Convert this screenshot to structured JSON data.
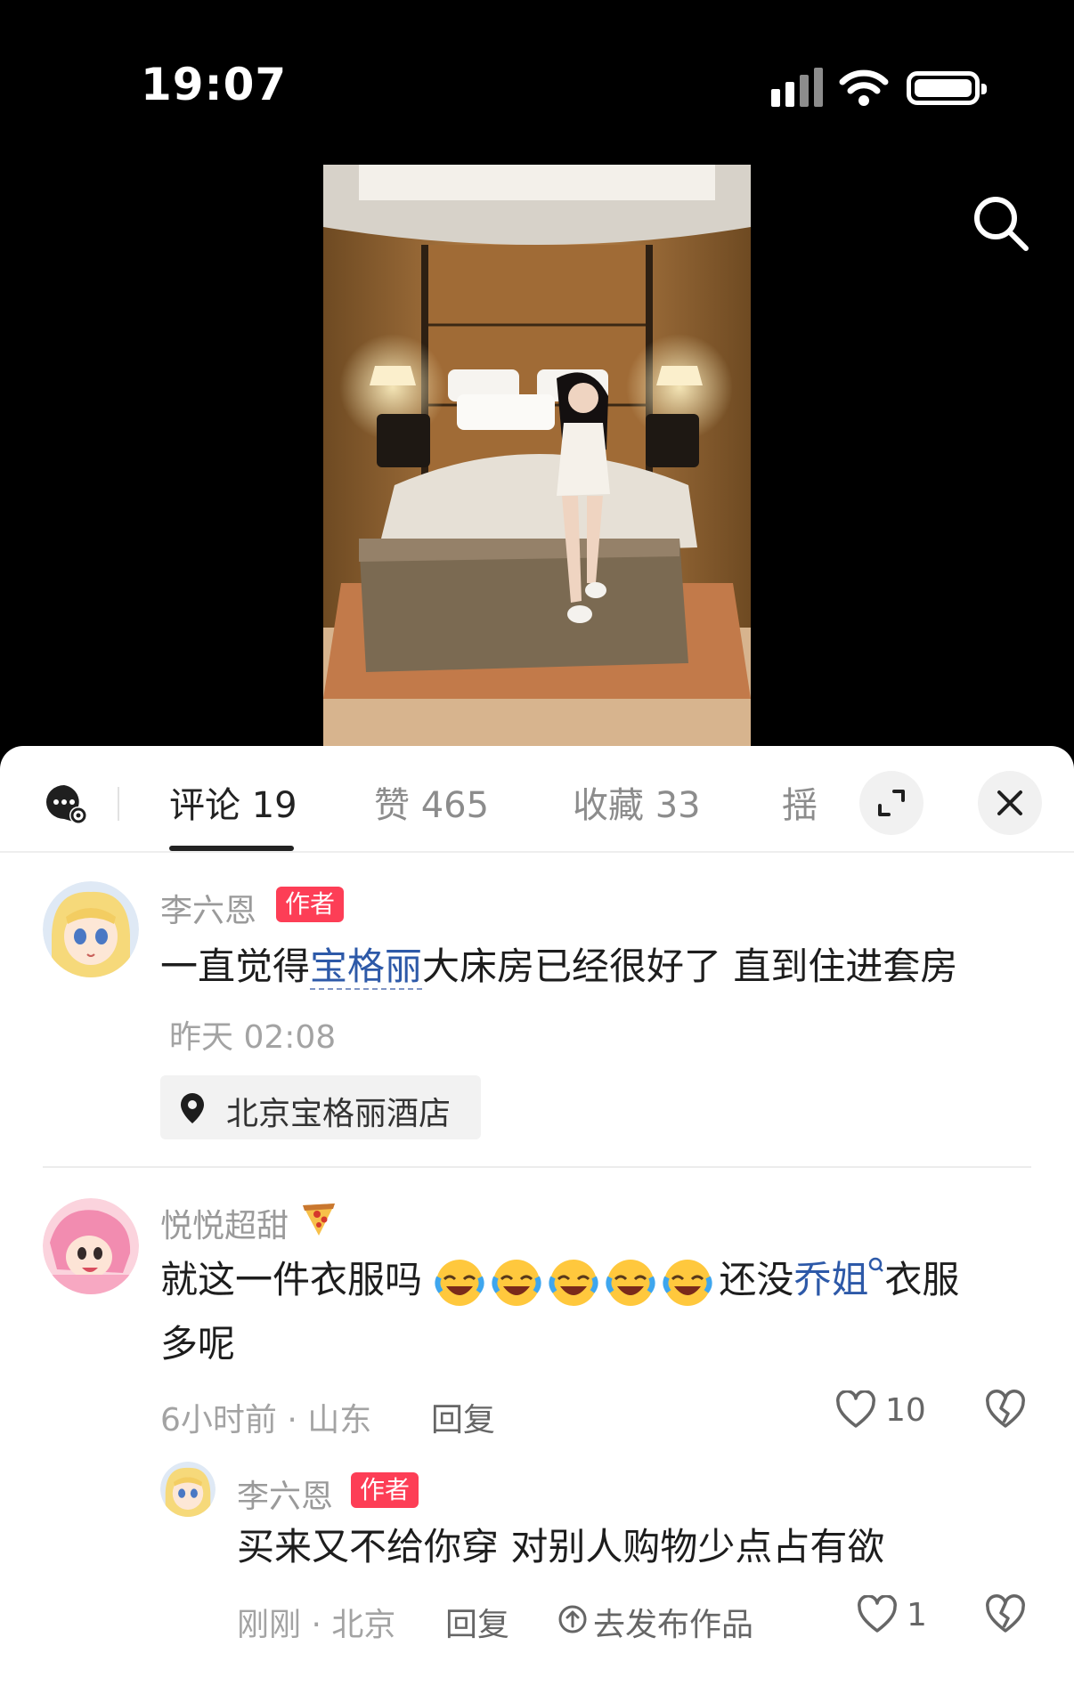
{
  "status_bar": {
    "time": "19:07"
  },
  "tabs": {
    "comments": "评论 19",
    "likes": "赞 465",
    "favorites": "收藏 33",
    "more_partial": "揺"
  },
  "comment1": {
    "author": "李六恩",
    "badge": "作者",
    "text_part1": "一直觉得",
    "text_link": "宝格丽",
    "text_part2": "大床房已经很好了 直到住进套房",
    "time": "昨天 02:08",
    "location": "北京宝格丽酒店"
  },
  "comment2": {
    "author": "悦悦超甜",
    "text_part1": "就这一件衣服吗",
    "text_part2": "还没",
    "text_link": "乔姐",
    "text_part3": "衣服",
    "text_line2": "多呢",
    "meta": "6小时前 · 山东",
    "reply_label": "回复",
    "like_count": "10"
  },
  "reply1": {
    "author": "李六恩",
    "badge": "作者",
    "text": "买来又不给你穿 对别人购物少点占有欲",
    "meta": "刚刚 · 北京",
    "reply_label": "回复",
    "publish_label": "去发布作品",
    "like_count": "1"
  },
  "icons": {
    "search": "search-icon",
    "chat": "comment-settings-icon",
    "expand": "expand-icon",
    "close": "close-icon",
    "location": "location-pin-icon",
    "heart": "heart-icon",
    "dislike": "broken-heart-icon",
    "emoji": "rofl-emoji",
    "pizza": "pizza-emoji"
  },
  "colors": {
    "badge": "#fd3e56",
    "link": "#2d59a8"
  }
}
